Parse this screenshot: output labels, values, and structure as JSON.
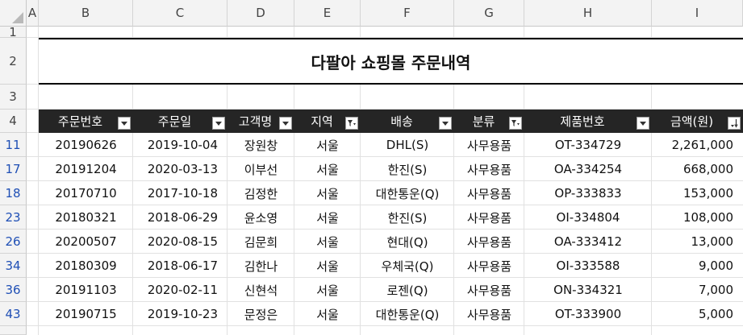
{
  "columns": [
    "A",
    "B",
    "C",
    "D",
    "E",
    "F",
    "G",
    "H",
    "I"
  ],
  "rows_visible": [
    "1",
    "2",
    "3",
    "4",
    "11",
    "17",
    "18",
    "23",
    "26",
    "34",
    "36",
    "43"
  ],
  "title": "다팔아 쇼핑몰 주문내역",
  "headers": [
    {
      "label": "주문번호",
      "filter": "dropdown"
    },
    {
      "label": "주문일",
      "filter": "dropdown"
    },
    {
      "label": "고객명",
      "filter": "dropdown"
    },
    {
      "label": "지역",
      "filter": "filtered"
    },
    {
      "label": "배송",
      "filter": "dropdown"
    },
    {
      "label": "분류",
      "filter": "filtered"
    },
    {
      "label": "제품번호",
      "filter": "dropdown"
    },
    {
      "label": "금액(원)",
      "filter": "sorted-desc"
    }
  ],
  "records": [
    {
      "row": "11",
      "order_no": "20190626",
      "date": "2019-10-04",
      "customer": "장원창",
      "region": "서울",
      "shipping": "DHL(S)",
      "category": "사무용품",
      "product": "OT-334729",
      "amount": "2,261,000"
    },
    {
      "row": "17",
      "order_no": "20191204",
      "date": "2020-03-13",
      "customer": "이부선",
      "region": "서울",
      "shipping": "한진(S)",
      "category": "사무용품",
      "product": "OA-334254",
      "amount": "668,000"
    },
    {
      "row": "18",
      "order_no": "20170710",
      "date": "2017-10-18",
      "customer": "김정한",
      "region": "서울",
      "shipping": "대한통운(Q)",
      "category": "사무용품",
      "product": "OP-333833",
      "amount": "153,000"
    },
    {
      "row": "23",
      "order_no": "20180321",
      "date": "2018-06-29",
      "customer": "윤소영",
      "region": "서울",
      "shipping": "한진(S)",
      "category": "사무용품",
      "product": "OI-334804",
      "amount": "108,000"
    },
    {
      "row": "26",
      "order_no": "20200507",
      "date": "2020-08-15",
      "customer": "김문희",
      "region": "서울",
      "shipping": "현대(Q)",
      "category": "사무용품",
      "product": "OA-333412",
      "amount": "13,000"
    },
    {
      "row": "34",
      "order_no": "20180309",
      "date": "2018-06-17",
      "customer": "김한나",
      "region": "서울",
      "shipping": "우체국(Q)",
      "category": "사무용품",
      "product": "OI-333588",
      "amount": "9,000"
    },
    {
      "row": "36",
      "order_no": "20191103",
      "date": "2020-02-11",
      "customer": "신현석",
      "region": "서울",
      "shipping": "로젠(Q)",
      "category": "사무용품",
      "product": "ON-334321",
      "amount": "7,000"
    },
    {
      "row": "43",
      "order_no": "20190715",
      "date": "2019-10-23",
      "customer": "문정은",
      "region": "서울",
      "shipping": "대한통운(Q)",
      "category": "사무용품",
      "product": "OT-333900",
      "amount": "5,000"
    }
  ],
  "colors": {
    "header_bg": "#252525",
    "header_text": "#ffffff",
    "filtered_row_number": "#1f4fb5",
    "gridline": "#e1e1e1"
  }
}
